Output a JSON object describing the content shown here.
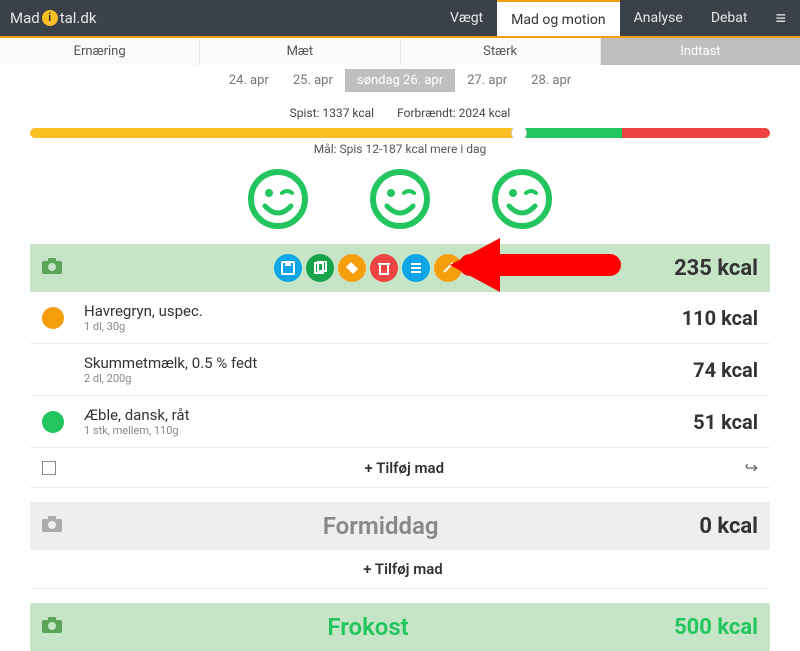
{
  "brand": {
    "pre": "Mad",
    "post": "tal.dk",
    "o": "i"
  },
  "nav": {
    "vaegt": "Vægt",
    "mad": "Mad og motion",
    "analyse": "Analyse",
    "debat": "Debat"
  },
  "subnav": {
    "er": "Ernæring",
    "maet": "Mæt",
    "staerk": "Stærk",
    "indtast": "Indtast"
  },
  "dates": {
    "d1": "24. apr",
    "d2": "25. apr",
    "d3": "søndag 26. apr",
    "d4": "27. apr",
    "d5": "28. apr"
  },
  "summary": {
    "spist": "Spist: 1337 kcal",
    "forb": "Forbrændt: 2024 kcal"
  },
  "goal": "Mål: Spis 12-187 kcal mere i dag",
  "meal1": {
    "kcal": "235 kcal",
    "items": [
      {
        "name": "Havregryn, uspec.",
        "sub": "1 dl, 30g",
        "kcal": "110 kcal"
      },
      {
        "name": "Skummetmælk, 0.5 % fedt",
        "sub": "2 dl, 200g",
        "kcal": "74 kcal"
      },
      {
        "name": "Æble, dansk, råt",
        "sub": "1 stk, mellem, 110g",
        "kcal": "51 kcal"
      }
    ],
    "add": "Tilføj mad"
  },
  "meal2": {
    "title": "Formiddag",
    "kcal": "0 kcal",
    "add": "Tilføj mad"
  },
  "meal3": {
    "title": "Frokost",
    "kcal": "500 kcal"
  },
  "plus": "+ "
}
